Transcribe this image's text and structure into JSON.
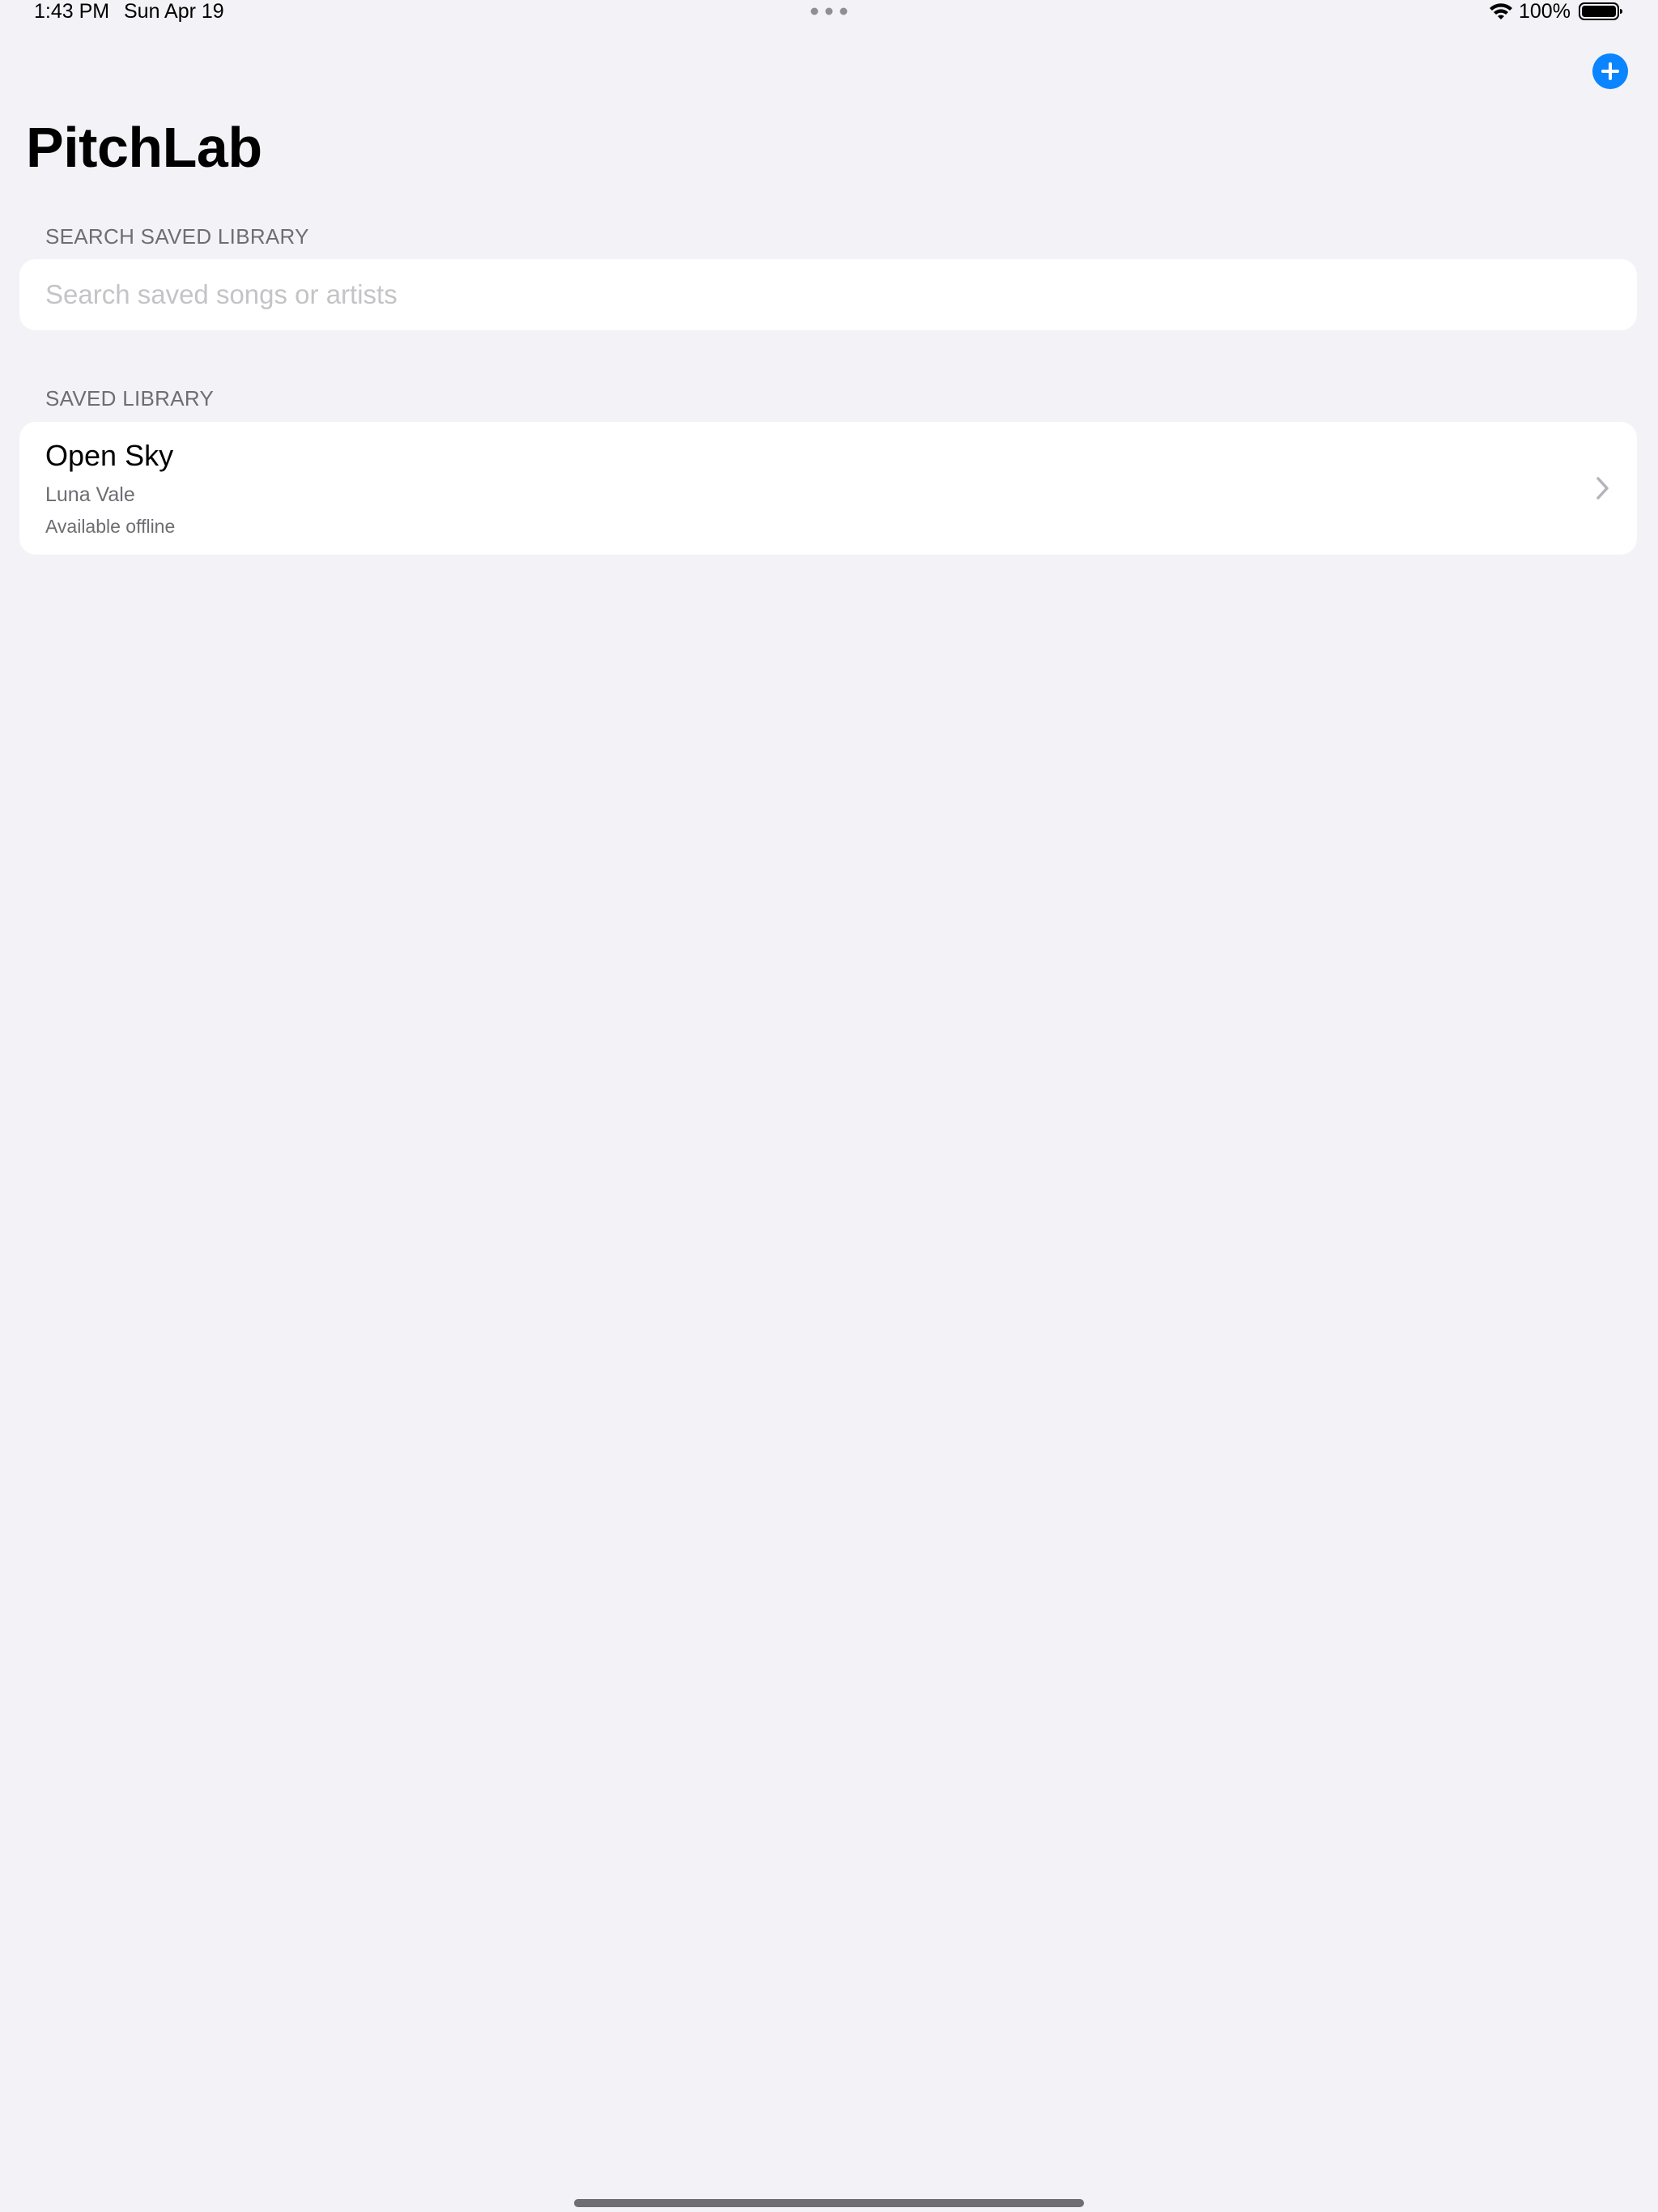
{
  "status_bar": {
    "time": "1:43 PM",
    "date": "Sun Apr 19",
    "battery_percent": "100%",
    "icons": [
      "multitask-dots-icon",
      "wifi-icon",
      "battery-icon"
    ]
  },
  "header": {
    "add_icon": "plus-circle-icon",
    "title": "PitchLab"
  },
  "search": {
    "section_label": "SEARCH SAVED LIBRARY",
    "placeholder": "Search saved songs or artists",
    "value": ""
  },
  "library": {
    "section_label": "SAVED LIBRARY",
    "items": [
      {
        "title": "Open Sky",
        "artist": "Luna Vale",
        "status": "Available offline",
        "chevron_icon": "chevron-right-icon"
      }
    ]
  },
  "colors": {
    "background": "#f2f2f7",
    "accent": "#0a84ff",
    "secondary_text": "#6d6d72",
    "placeholder_text": "#c4c4c7",
    "card": "#ffffff"
  }
}
